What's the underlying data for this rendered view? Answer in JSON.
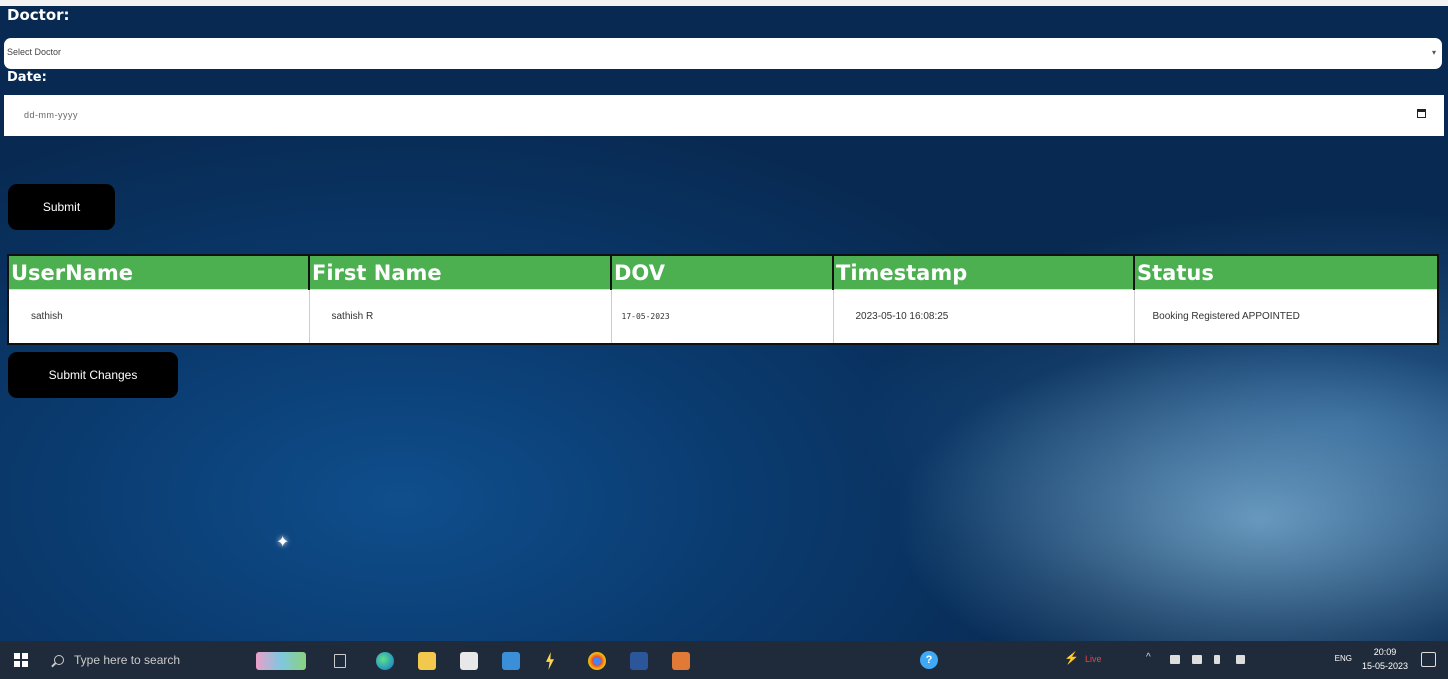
{
  "form": {
    "doctor_label": "Doctor:",
    "doctor_select_value": "Select Doctor",
    "date_label": "Date:",
    "date_placeholder": "dd-mm-yyyy",
    "submit_label": "Submit",
    "submit_changes_label": "Submit Changes"
  },
  "table": {
    "headers": [
      "UserName",
      "First Name",
      "DOV",
      "Timestamp",
      "Status"
    ],
    "rows": [
      {
        "username": "sathish",
        "first_name": "sathish R",
        "dov": "17-05-2023",
        "timestamp": "2023-05-10 16:08:25",
        "status": "Booking Registered APPOINTED"
      }
    ],
    "header_color": "#4caf50"
  },
  "taskbar": {
    "search_placeholder": "Type here to search",
    "language": "ENG",
    "time": "20:09",
    "date": "15-05-2023",
    "live_label": "Live",
    "apps": [
      "windows-icon",
      "task-view-icon",
      "edge-icon",
      "file-explorer-icon",
      "store-icon",
      "mail-icon",
      "chrome-icon",
      "word-icon",
      "app-icon"
    ]
  }
}
